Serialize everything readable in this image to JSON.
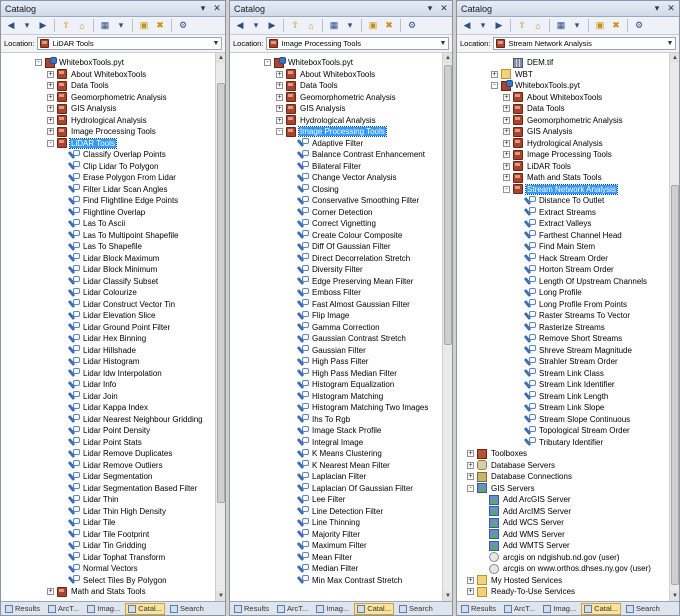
{
  "ui": {
    "expand": "+",
    "collapse": "-",
    "dropdown": "▼",
    "pin": "▾",
    "close": "✕",
    "up_arrow": "▲",
    "down_arrow": "▼"
  },
  "colors": {
    "selected": "#3399ff",
    "tab_active": "#fbe39b",
    "title_bar": "#cfdaea"
  },
  "panels": [
    {
      "title": "Catalog",
      "location_label": "Location:",
      "location_value": "LiDAR Tools",
      "tabs": [
        {
          "label": "Results",
          "active": false
        },
        {
          "label": "ArcT...",
          "active": false
        },
        {
          "label": "Imag...",
          "active": false
        },
        {
          "label": "Catal...",
          "active": true
        },
        {
          "label": "Search",
          "active": false
        }
      ],
      "items": [
        {
          "label": "WhiteboxTools.pyt",
          "icon": "pyt",
          "depth": 2,
          "exp": "-"
        },
        {
          "label": "About WhiteboxTools",
          "icon": "tbx",
          "depth": 3,
          "exp": "+"
        },
        {
          "label": "Data Tools",
          "icon": "tbx",
          "depth": 3,
          "exp": "+"
        },
        {
          "label": "Geomorphometric Analysis",
          "icon": "tbx",
          "depth": 3,
          "exp": "+"
        },
        {
          "label": "GIS Analysis",
          "icon": "tbx",
          "depth": 3,
          "exp": "+"
        },
        {
          "label": "Hydrological Analysis",
          "icon": "tbx",
          "depth": 3,
          "exp": "+"
        },
        {
          "label": "Image Processing Tools",
          "icon": "tbx",
          "depth": 3,
          "exp": "+"
        },
        {
          "label": "LiDAR Tools",
          "icon": "tbx",
          "depth": 3,
          "exp": "-",
          "sel": true
        },
        {
          "label": "Classify Overlap Points",
          "icon": "tool",
          "depth": 4
        },
        {
          "label": "Clip Lidar To Polygon",
          "icon": "tool",
          "depth": 4
        },
        {
          "label": "Erase Polygon From Lidar",
          "icon": "tool",
          "depth": 4
        },
        {
          "label": "Filter Lidar Scan Angles",
          "icon": "tool",
          "depth": 4
        },
        {
          "label": "Find Flightline Edge Points",
          "icon": "tool",
          "depth": 4
        },
        {
          "label": "Flightline Overlap",
          "icon": "tool",
          "depth": 4
        },
        {
          "label": "Las To Ascii",
          "icon": "tool",
          "depth": 4
        },
        {
          "label": "Las To Multipoint Shapefile",
          "icon": "tool",
          "depth": 4
        },
        {
          "label": "Las To Shapefile",
          "icon": "tool",
          "depth": 4
        },
        {
          "label": "Lidar Block Maximum",
          "icon": "tool",
          "depth": 4
        },
        {
          "label": "Lidar Block Minimum",
          "icon": "tool",
          "depth": 4
        },
        {
          "label": "Lidar Classify Subset",
          "icon": "tool",
          "depth": 4
        },
        {
          "label": "Lidar Colourize",
          "icon": "tool",
          "depth": 4
        },
        {
          "label": "Lidar Construct Vector Tin",
          "icon": "tool",
          "depth": 4
        },
        {
          "label": "Lidar Elevation Slice",
          "icon": "tool",
          "depth": 4
        },
        {
          "label": "Lidar Ground Point Filter",
          "icon": "tool",
          "depth": 4
        },
        {
          "label": "Lidar Hex Binning",
          "icon": "tool",
          "depth": 4
        },
        {
          "label": "Lidar Hillshade",
          "icon": "tool",
          "depth": 4
        },
        {
          "label": "Lidar Histogram",
          "icon": "tool",
          "depth": 4
        },
        {
          "label": "Lidar Idw Interpolation",
          "icon": "tool",
          "depth": 4
        },
        {
          "label": "Lidar Info",
          "icon": "tool",
          "depth": 4
        },
        {
          "label": "Lidar Join",
          "icon": "tool",
          "depth": 4
        },
        {
          "label": "Lidar Kappa Index",
          "icon": "tool",
          "depth": 4
        },
        {
          "label": "Lidar Nearest Neighbour Gridding",
          "icon": "tool",
          "depth": 4
        },
        {
          "label": "Lidar Point Density",
          "icon": "tool",
          "depth": 4
        },
        {
          "label": "Lidar Point Stats",
          "icon": "tool",
          "depth": 4
        },
        {
          "label": "Lidar Remove Duplicates",
          "icon": "tool",
          "depth": 4
        },
        {
          "label": "Lidar Remove Outliers",
          "icon": "tool",
          "depth": 4
        },
        {
          "label": "Lidar Segmentation",
          "icon": "tool",
          "depth": 4
        },
        {
          "label": "Lidar Segmentation Based Filter",
          "icon": "tool",
          "depth": 4
        },
        {
          "label": "Lidar Thin",
          "icon": "tool",
          "depth": 4
        },
        {
          "label": "Lidar Thin High Density",
          "icon": "tool",
          "depth": 4
        },
        {
          "label": "Lidar Tile",
          "icon": "tool",
          "depth": 4
        },
        {
          "label": "Lidar Tile Footprint",
          "icon": "tool",
          "depth": 4
        },
        {
          "label": "Lidar Tin Gridding",
          "icon": "tool",
          "depth": 4
        },
        {
          "label": "Lidar Tophat Transform",
          "icon": "tool",
          "depth": 4
        },
        {
          "label": "Normal Vectors",
          "icon": "tool",
          "depth": 4
        },
        {
          "label": "Select Tiles By Polygon",
          "icon": "tool",
          "depth": 4
        },
        {
          "label": "Math and Stats Tools",
          "icon": "tbx",
          "depth": 3,
          "exp": "+"
        }
      ]
    },
    {
      "title": "Catalog",
      "location_label": "Location:",
      "location_value": "Image Processing Tools",
      "tabs": [
        {
          "label": "Results",
          "active": false
        },
        {
          "label": "ArcT...",
          "active": false
        },
        {
          "label": "Imag...",
          "active": false
        },
        {
          "label": "Catal...",
          "active": true
        },
        {
          "label": "Search",
          "active": false
        }
      ],
      "items": [
        {
          "label": "WhiteboxTools.pyt",
          "icon": "pyt",
          "depth": 2,
          "exp": "-"
        },
        {
          "label": "About WhiteboxTools",
          "icon": "tbx",
          "depth": 3,
          "exp": "+"
        },
        {
          "label": "Data Tools",
          "icon": "tbx",
          "depth": 3,
          "exp": "+"
        },
        {
          "label": "Geomorphometric Analysis",
          "icon": "tbx",
          "depth": 3,
          "exp": "+"
        },
        {
          "label": "GIS Analysis",
          "icon": "tbx",
          "depth": 3,
          "exp": "+"
        },
        {
          "label": "Hydrological Analysis",
          "icon": "tbx",
          "depth": 3,
          "exp": "+"
        },
        {
          "label": "Image Processing Tools",
          "icon": "tbx",
          "depth": 3,
          "exp": "-",
          "sel": true
        },
        {
          "label": "Adaptive Filter",
          "icon": "tool",
          "depth": 4
        },
        {
          "label": "Balance Contrast Enhancement",
          "icon": "tool",
          "depth": 4
        },
        {
          "label": "Bilateral Filter",
          "icon": "tool",
          "depth": 4
        },
        {
          "label": "Change Vector Analysis",
          "icon": "tool",
          "depth": 4
        },
        {
          "label": "Closing",
          "icon": "tool",
          "depth": 4
        },
        {
          "label": "Conservative Smoothing Filter",
          "icon": "tool",
          "depth": 4
        },
        {
          "label": "Corner Detection",
          "icon": "tool",
          "depth": 4
        },
        {
          "label": "Correct Vignetting",
          "icon": "tool",
          "depth": 4
        },
        {
          "label": "Create Colour Composite",
          "icon": "tool",
          "depth": 4
        },
        {
          "label": "Diff Of Gaussian Filter",
          "icon": "tool",
          "depth": 4
        },
        {
          "label": "Direct Decorrelation Stretch",
          "icon": "tool",
          "depth": 4
        },
        {
          "label": "Diversity Filter",
          "icon": "tool",
          "depth": 4
        },
        {
          "label": "Edge Preserving Mean Filter",
          "icon": "tool",
          "depth": 4
        },
        {
          "label": "Emboss Filter",
          "icon": "tool",
          "depth": 4
        },
        {
          "label": "Fast Almost Gaussian Filter",
          "icon": "tool",
          "depth": 4
        },
        {
          "label": "Flip Image",
          "icon": "tool",
          "depth": 4
        },
        {
          "label": "Gamma Correction",
          "icon": "tool",
          "depth": 4
        },
        {
          "label": "Gaussian Contrast Stretch",
          "icon": "tool",
          "depth": 4
        },
        {
          "label": "Gaussian Filter",
          "icon": "tool",
          "depth": 4
        },
        {
          "label": "High Pass Filter",
          "icon": "tool",
          "depth": 4
        },
        {
          "label": "High Pass Median Filter",
          "icon": "tool",
          "depth": 4
        },
        {
          "label": "Histogram Equalization",
          "icon": "tool",
          "depth": 4
        },
        {
          "label": "Histogram Matching",
          "icon": "tool",
          "depth": 4
        },
        {
          "label": "Histogram Matching Two Images",
          "icon": "tool",
          "depth": 4
        },
        {
          "label": "Ihs To Rgb",
          "icon": "tool",
          "depth": 4
        },
        {
          "label": "Image Stack Profile",
          "icon": "tool",
          "depth": 4
        },
        {
          "label": "Integral Image",
          "icon": "tool",
          "depth": 4
        },
        {
          "label": "K Means Clustering",
          "icon": "tool",
          "depth": 4
        },
        {
          "label": "K Nearest Mean Filter",
          "icon": "tool",
          "depth": 4
        },
        {
          "label": "Laplacian Filter",
          "icon": "tool",
          "depth": 4
        },
        {
          "label": "Laplacian Of Gaussian Filter",
          "icon": "tool",
          "depth": 4
        },
        {
          "label": "Lee Filter",
          "icon": "tool",
          "depth": 4
        },
        {
          "label": "Line Detection Filter",
          "icon": "tool",
          "depth": 4
        },
        {
          "label": "Line Thinning",
          "icon": "tool",
          "depth": 4
        },
        {
          "label": "Majority Filter",
          "icon": "tool",
          "depth": 4
        },
        {
          "label": "Maximum Filter",
          "icon": "tool",
          "depth": 4
        },
        {
          "label": "Mean Filter",
          "icon": "tool",
          "depth": 4
        },
        {
          "label": "Median Filter",
          "icon": "tool",
          "depth": 4
        },
        {
          "label": "Min Max Contrast Stretch",
          "icon": "tool",
          "depth": 4
        }
      ]
    },
    {
      "title": "Catalog",
      "location_label": "Location:",
      "location_value": "Stream Network Analysis",
      "tabs": [
        {
          "label": "Results",
          "active": false
        },
        {
          "label": "ArcT...",
          "active": false
        },
        {
          "label": "Imag...",
          "active": false
        },
        {
          "label": "Catal...",
          "active": true
        },
        {
          "label": "Search",
          "active": false
        }
      ],
      "items": [
        {
          "label": "DEM.tif",
          "icon": "dem",
          "depth": 3
        },
        {
          "label": "WBT",
          "icon": "fld",
          "depth": 2,
          "exp": "+"
        },
        {
          "label": "WhiteboxTools.pyt",
          "icon": "pyt",
          "depth": 2,
          "exp": "-"
        },
        {
          "label": "About WhiteboxTools",
          "icon": "tbx",
          "depth": 3,
          "exp": "+"
        },
        {
          "label": "Data Tools",
          "icon": "tbx",
          "depth": 3,
          "exp": "+"
        },
        {
          "label": "Geomorphometric Analysis",
          "icon": "tbx",
          "depth": 3,
          "exp": "+"
        },
        {
          "label": "GIS Analysis",
          "icon": "tbx",
          "depth": 3,
          "exp": "+"
        },
        {
          "label": "Hydrological Analysis",
          "icon": "tbx",
          "depth": 3,
          "exp": "+"
        },
        {
          "label": "Image Processing Tools",
          "icon": "tbx",
          "depth": 3,
          "exp": "+"
        },
        {
          "label": "LiDAR Tools",
          "icon": "tbx",
          "depth": 3,
          "exp": "+"
        },
        {
          "label": "Math and Stats Tools",
          "icon": "tbx",
          "depth": 3,
          "exp": "+"
        },
        {
          "label": "Stream Network Analysis",
          "icon": "tbx",
          "depth": 3,
          "exp": "-",
          "sel": true
        },
        {
          "label": "Distance To Outlet",
          "icon": "tool",
          "depth": 4
        },
        {
          "label": "Extract Streams",
          "icon": "tool",
          "depth": 4
        },
        {
          "label": "Extract Valleys",
          "icon": "tool",
          "depth": 4
        },
        {
          "label": "Farthest Channel Head",
          "icon": "tool",
          "depth": 4
        },
        {
          "label": "Find Main Stem",
          "icon": "tool",
          "depth": 4
        },
        {
          "label": "Hack Stream Order",
          "icon": "tool",
          "depth": 4
        },
        {
          "label": "Horton Stream Order",
          "icon": "tool",
          "depth": 4
        },
        {
          "label": "Length Of Upstream Channels",
          "icon": "tool",
          "depth": 4
        },
        {
          "label": "Long Profile",
          "icon": "tool",
          "depth": 4
        },
        {
          "label": "Long Profile From Points",
          "icon": "tool",
          "depth": 4
        },
        {
          "label": "Raster Streams To Vector",
          "icon": "tool",
          "depth": 4
        },
        {
          "label": "Rasterize Streams",
          "icon": "tool",
          "depth": 4
        },
        {
          "label": "Remove Short Streams",
          "icon": "tool",
          "depth": 4
        },
        {
          "label": "Shreve Stream Magnitude",
          "icon": "tool",
          "depth": 4
        },
        {
          "label": "Strahler Stream Order",
          "icon": "tool",
          "depth": 4
        },
        {
          "label": "Stream Link Class",
          "icon": "tool",
          "depth": 4
        },
        {
          "label": "Stream Link Identifier",
          "icon": "tool",
          "depth": 4
        },
        {
          "label": "Stream Link Length",
          "icon": "tool",
          "depth": 4
        },
        {
          "label": "Stream Link Slope",
          "icon": "tool",
          "depth": 4
        },
        {
          "label": "Stream Slope Continuous",
          "icon": "tool",
          "depth": 4
        },
        {
          "label": "Topological Stream Order",
          "icon": "tool",
          "depth": 4
        },
        {
          "label": "Tributary Identifier",
          "icon": "tool",
          "depth": 4
        },
        {
          "label": "Toolboxes",
          "icon": "tbxs",
          "depth": 0,
          "exp": "+"
        },
        {
          "label": "Database Servers",
          "icon": "db",
          "depth": 0,
          "exp": "+"
        },
        {
          "label": "Database Connections",
          "icon": "dbc",
          "depth": 0,
          "exp": "+"
        },
        {
          "label": "GIS Servers",
          "icon": "srv",
          "depth": 0,
          "exp": "-"
        },
        {
          "label": "Add ArcGIS Server",
          "icon": "srv",
          "depth": 1
        },
        {
          "label": "Add ArcIMS Server",
          "icon": "srv",
          "depth": 1
        },
        {
          "label": "Add WCS Server",
          "icon": "srv",
          "depth": 1
        },
        {
          "label": "Add WMS Server",
          "icon": "srv",
          "depth": 1
        },
        {
          "label": "Add WMTS Server",
          "icon": "srv",
          "depth": 1
        },
        {
          "label": "arcgis on ndgishub.nd.gov (user)",
          "icon": "web",
          "depth": 1
        },
        {
          "label": "arcgis on www.orthos.dhses.ny.gov (user)",
          "icon": "web",
          "depth": 1
        },
        {
          "label": "My Hosted Services",
          "icon": "fld",
          "depth": 0,
          "exp": "+"
        },
        {
          "label": "Ready-To-Use Services",
          "icon": "fld",
          "depth": 0,
          "exp": "+"
        }
      ]
    }
  ]
}
